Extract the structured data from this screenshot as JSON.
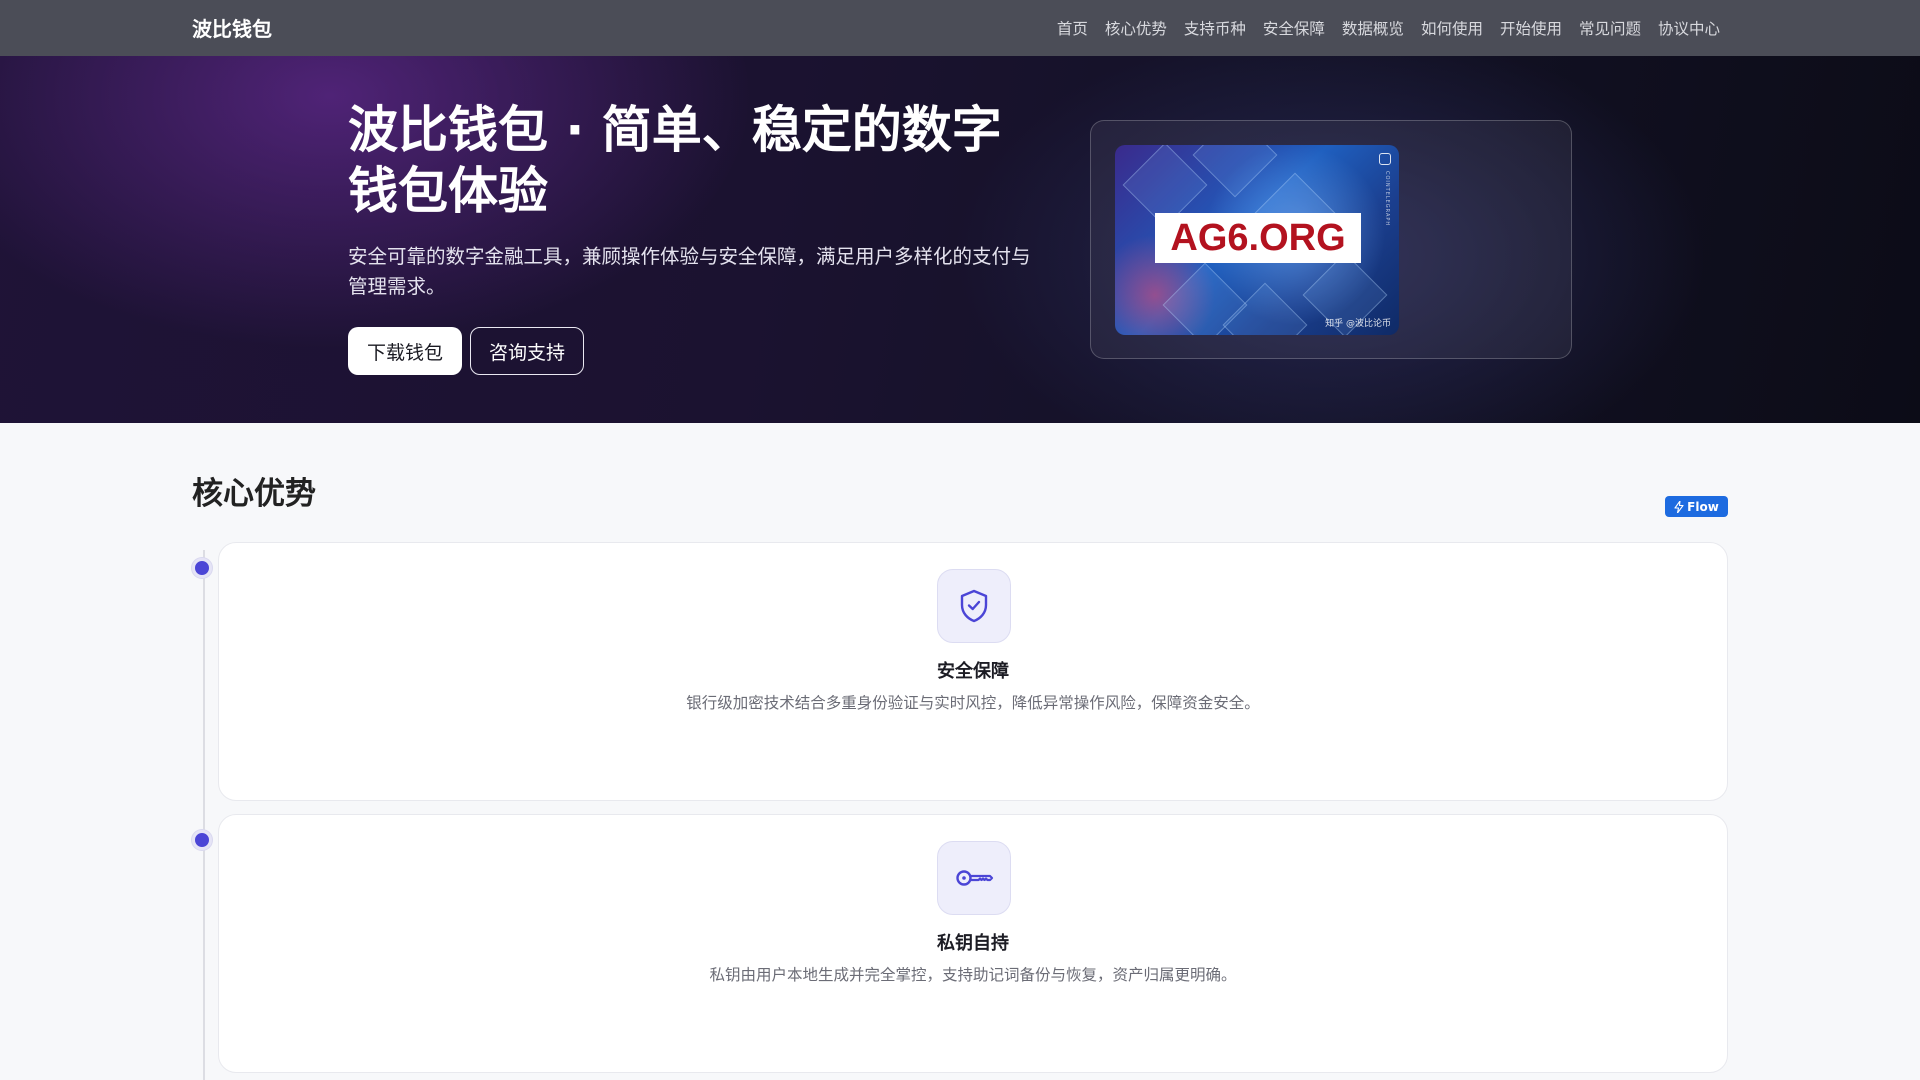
{
  "nav": {
    "brand": "波比钱包",
    "links": [
      "首页",
      "核心优势",
      "支持币种",
      "安全保障",
      "数据概览",
      "如何使用",
      "开始使用",
      "常见问题",
      "协议中心"
    ]
  },
  "hero": {
    "title": "波比钱包 · 简单、稳定的数字钱包体验",
    "subtitle": "安全可靠的数字金融工具，兼顾操作体验与安全保障，满足用户多样化的支付与管理需求。",
    "primary_button": "下载钱包",
    "secondary_button": "咨询支持",
    "image": {
      "watermark": "AG6.ORG",
      "caption": "知乎 @波比论币",
      "vertical_label": "COINTELEGRAPH"
    }
  },
  "section": {
    "title": "核心优势",
    "badge": "Flow",
    "cards": [
      {
        "title": "安全保障",
        "description": "银行级加密技术结合多重身份验证与实时风控，降低异常操作风险，保障资金安全。",
        "icon": "shield-check-icon"
      },
      {
        "title": "私钥自持",
        "description": "私钥由用户本地生成并完全掌控，支持助记词备份与恢复，资产归属更明确。",
        "icon": "key-icon"
      }
    ]
  },
  "colors": {
    "nav_bg": "#4b4d57",
    "accent": "#4b45d6",
    "badge": "#1d6be0",
    "watermark": "#b3121f"
  }
}
